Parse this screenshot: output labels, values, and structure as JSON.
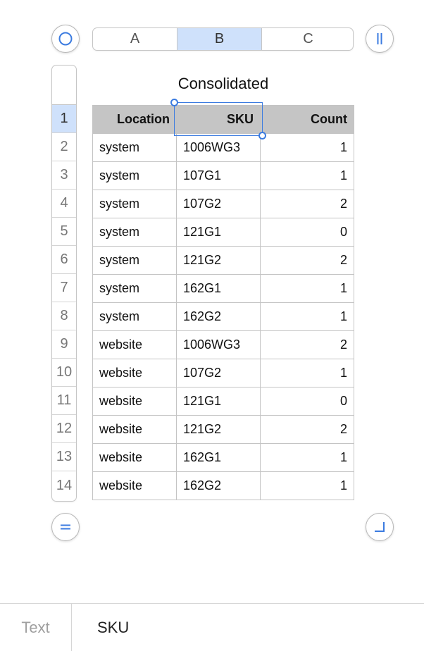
{
  "toolbar": {
    "columns": [
      {
        "label": "A",
        "selected": false
      },
      {
        "label": "B",
        "selected": true
      },
      {
        "label": "C",
        "selected": false
      }
    ]
  },
  "table": {
    "title": "Consolidated",
    "headers": [
      "Location",
      "SKU",
      "Count"
    ],
    "rows": [
      [
        "system",
        "1006WG3",
        "1"
      ],
      [
        "system",
        "107G1",
        "1"
      ],
      [
        "system",
        "107G2",
        "2"
      ],
      [
        "system",
        "121G1",
        "0"
      ],
      [
        "system",
        "121G2",
        "2"
      ],
      [
        "system",
        "162G1",
        "1"
      ],
      [
        "system",
        "162G2",
        "1"
      ],
      [
        "website",
        "1006WG3",
        "2"
      ],
      [
        "website",
        "107G2",
        "1"
      ],
      [
        "website",
        "121G1",
        "0"
      ],
      [
        "website",
        "121G2",
        "2"
      ],
      [
        "website",
        "162G1",
        "1"
      ],
      [
        "website",
        "162G2",
        "1"
      ]
    ],
    "row_numbers": [
      "1",
      "2",
      "3",
      "4",
      "5",
      "6",
      "7",
      "8",
      "9",
      "10",
      "11",
      "12",
      "13",
      "14"
    ],
    "selected_row_number": "1"
  },
  "bottom_bar": {
    "label": "Text",
    "value": "SKU"
  },
  "colors": {
    "accent": "#3b7be0",
    "selection_fill": "#cfe1fb",
    "header_fill": "#c5c5c5"
  },
  "icons": {
    "select_all": "circle-icon",
    "freeze": "freeze-columns-icon",
    "add_row": "equals-icon",
    "resize": "corner-resize-icon"
  }
}
